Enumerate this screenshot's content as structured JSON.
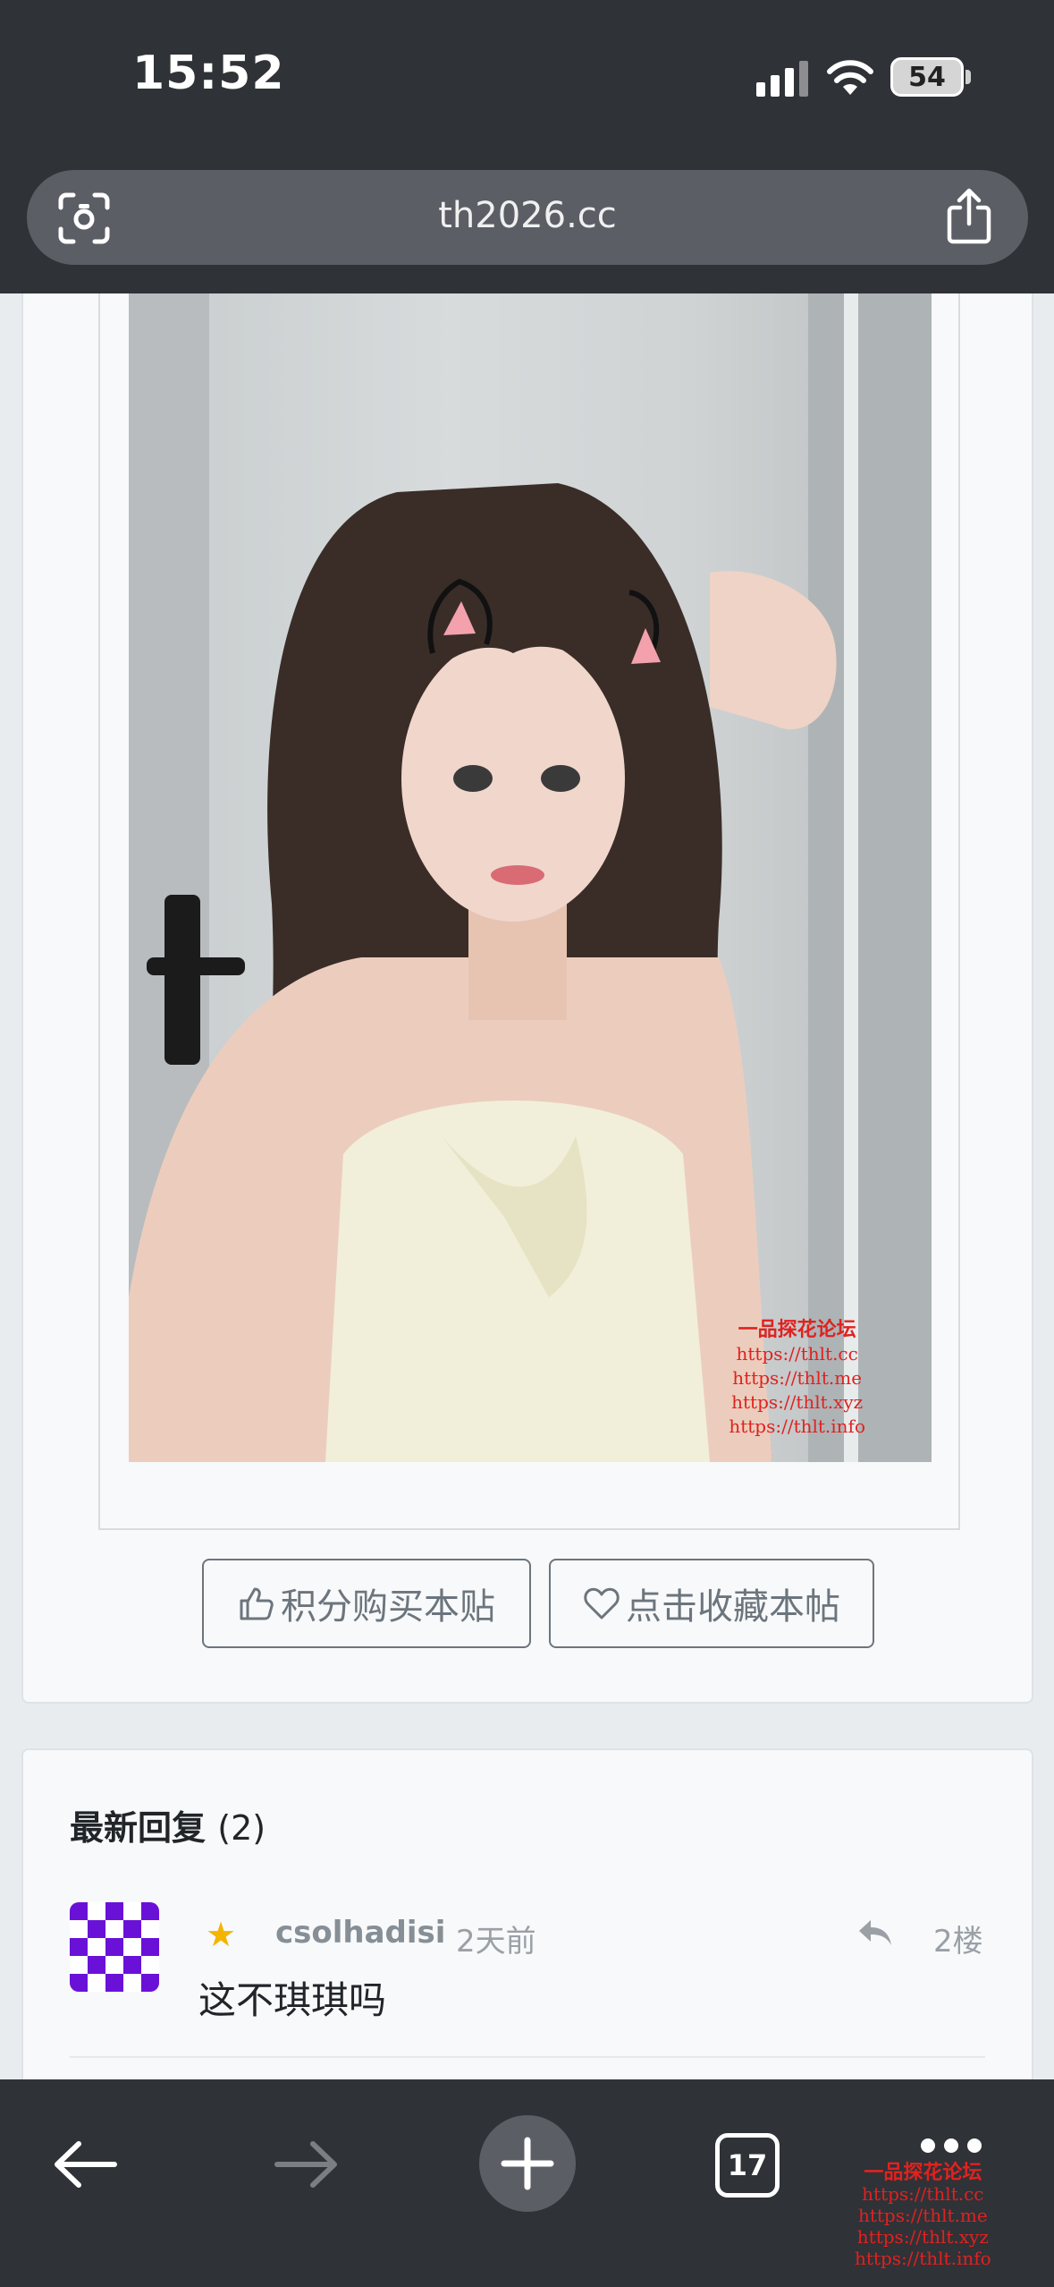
{
  "status_bar": {
    "time": "15:52",
    "battery": "54"
  },
  "url_bar": {
    "url": "th2026.cc"
  },
  "post": {
    "image_watermark": [
      "一品探花论坛",
      "https://thlt.cc",
      "https://thlt.me",
      "https://thlt.xyz",
      "https://thlt.info"
    ],
    "buy_button": "积分购买本贴",
    "favorite_button": "点击收藏本帖"
  },
  "replies": {
    "title": "最新回复",
    "count": "(2)",
    "items": [
      {
        "username": "csolhadisi",
        "time": "2天前",
        "floor": "2楼",
        "text": "这不琪琪吗"
      }
    ]
  },
  "toolbar": {
    "tab_count": "17",
    "watermark": [
      "一品探花论坛",
      "https://thlt.cc",
      "https://thlt.me",
      "https://thlt.xyz",
      "https://thlt.info"
    ]
  },
  "icons": [
    "signal-icon",
    "wifi-icon",
    "battery-icon",
    "visual-search-icon",
    "share-icon",
    "thumbs-up-icon",
    "heart-icon",
    "star-icon",
    "reply-icon",
    "back-arrow-icon",
    "forward-arrow-icon",
    "plus-icon",
    "tabs-icon",
    "more-icon"
  ],
  "colors": {
    "chrome": "#2f3237",
    "url_bar": "#5b5e64",
    "watermark": "#e0221f",
    "avatar": "#6a11d8"
  }
}
